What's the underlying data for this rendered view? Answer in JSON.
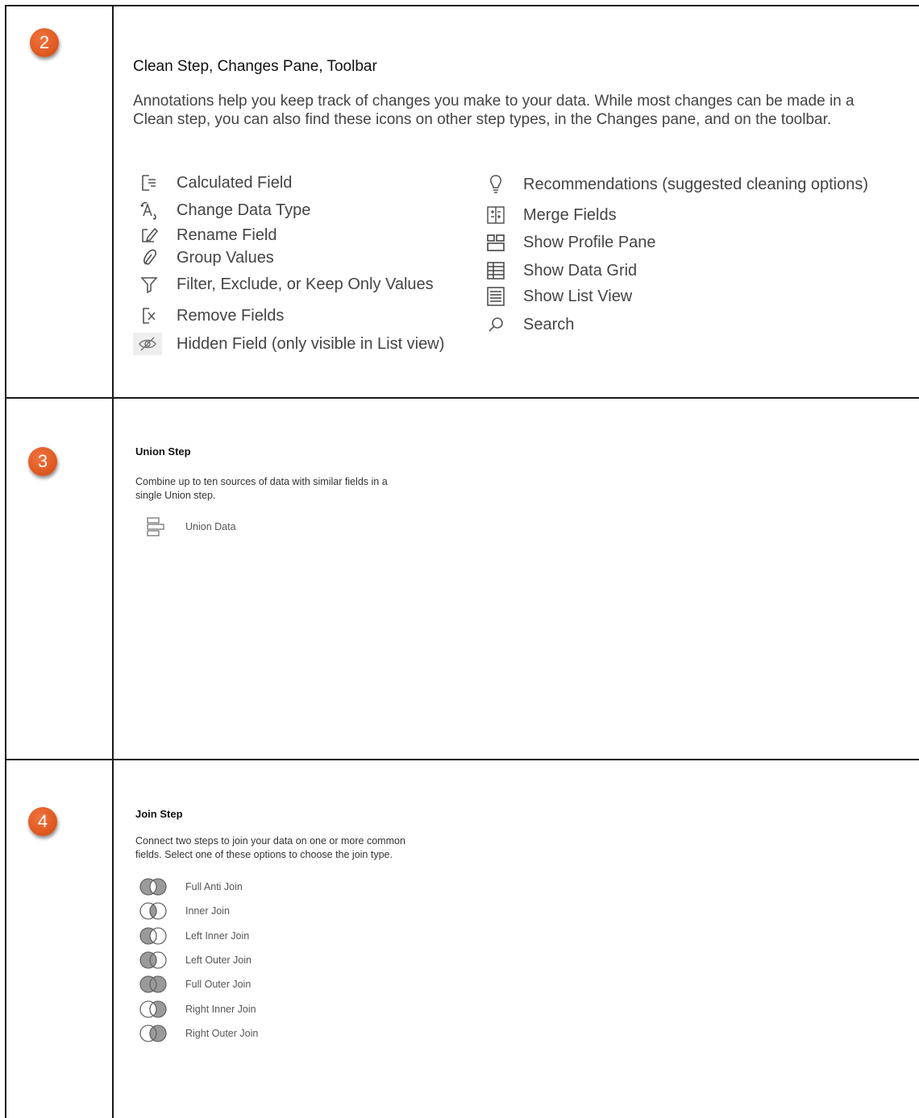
{
  "section2": {
    "number": "2",
    "title": "Clean Step, Changes Pane, Toolbar",
    "description": "Annotations help you keep track of changes you make to your data. While most changes can be made in a Clean step, you can also find these icons on other step types, in the Changes pane, and on the toolbar.",
    "left_items": [
      {
        "icon": "calculated-field-icon",
        "label": "Calculated Field"
      },
      {
        "icon": "change-data-type-icon",
        "label": "Change Data Type"
      },
      {
        "icon": "rename-field-icon",
        "label": "Rename Field"
      },
      {
        "icon": "group-values-icon",
        "label": "Group Values"
      },
      {
        "icon": "filter-icon",
        "label": "Filter, Exclude, or Keep Only  Values"
      },
      {
        "icon": "remove-fields-icon",
        "label": "Remove Fields"
      },
      {
        "icon": "hidden-field-icon",
        "label": "Hidden Field (only visible in List view)"
      }
    ],
    "right_items": [
      {
        "icon": "lightbulb-icon",
        "label": "Recommendations (suggested cleaning options)"
      },
      {
        "icon": "merge-fields-icon",
        "label": "Merge Fields"
      },
      {
        "icon": "profile-pane-icon",
        "label": "Show Profile Pane"
      },
      {
        "icon": "data-grid-icon",
        "label": "Show Data Grid"
      },
      {
        "icon": "list-view-icon",
        "label": "Show List View"
      },
      {
        "icon": "search-icon",
        "label": "Search"
      }
    ]
  },
  "section3": {
    "number": "3",
    "title": "Union Step",
    "description": "Combine up to ten sources of data with similar fields in a single Union step.",
    "items": [
      {
        "icon": "union-data-icon",
        "label": "Union Data"
      }
    ]
  },
  "section4": {
    "number": "4",
    "title": "Join Step",
    "description": "Connect two steps to join your data on one or more common fields. Select one of these options to choose the join type.",
    "items": [
      {
        "icon": "full-anti-join-icon",
        "label": "Full Anti Join"
      },
      {
        "icon": "inner-join-icon",
        "label": "Inner Join"
      },
      {
        "icon": "left-inner-join-icon",
        "label": "Left Inner Join"
      },
      {
        "icon": "left-outer-join-icon",
        "label": "Left Outer Join"
      },
      {
        "icon": "full-outer-join-icon",
        "label": "Full Outer Join"
      },
      {
        "icon": "right-inner-join-icon",
        "label": "Right Inner Join"
      },
      {
        "icon": "right-outer-join-icon",
        "label": "Right Outer Join"
      }
    ]
  },
  "colors": {
    "badge": "#e05a22",
    "border": "#1a1a1a",
    "icon": "#555555"
  }
}
